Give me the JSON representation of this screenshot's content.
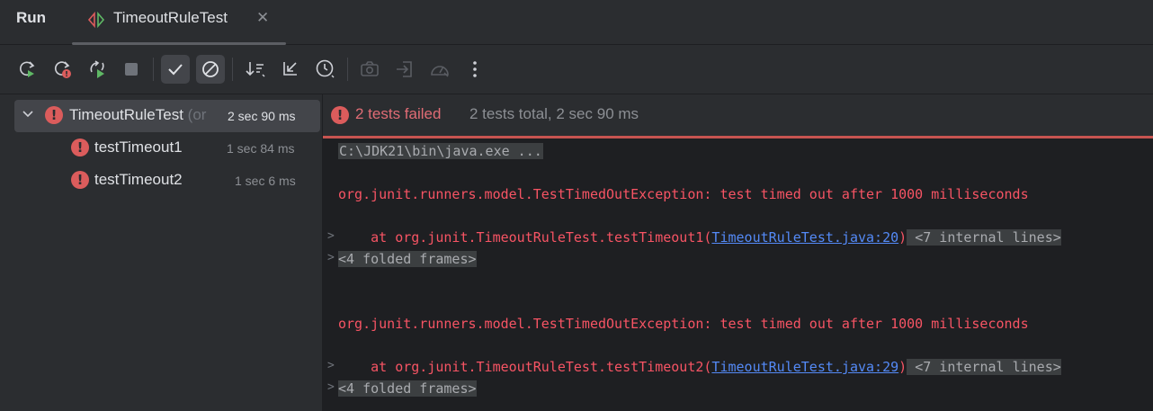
{
  "header": {
    "title": "Run",
    "tab_label": "TimeoutRuleTest",
    "close_glyph": "✕"
  },
  "toolbar": {
    "buttons": [
      "rerun-icon",
      "rerun-failed-icon",
      "toggle-autotest-icon",
      "stop-icon",
      "show-passed-icon",
      "show-ignored-icon",
      "sort-alphabetically-icon",
      "collapse-all-icon",
      "sort-by-duration-icon",
      "screenshot-icon",
      "import-tests-icon",
      "coverage-icon",
      "more-icon"
    ]
  },
  "tree": {
    "root": {
      "label": "TimeoutRuleTest",
      "suffix": "(or",
      "time": "2 sec 90 ms"
    },
    "children": [
      {
        "label": "testTimeout1",
        "time": "1 sec 84 ms"
      },
      {
        "label": "testTimeout2",
        "time": "1 sec 6 ms"
      }
    ]
  },
  "status": {
    "failed": "2 tests failed",
    "total": "2 tests total, 2 sec 90 ms"
  },
  "console": {
    "command": "C:\\JDK21\\bin\\java.exe ...",
    "exception": "org.junit.runners.model.TestTimedOutException: test timed out after 1000 milliseconds",
    "frame1_prefix": "    at org.junit.TimeoutRuleTest.testTimeout1(",
    "frame1_link": "TimeoutRuleTest.java:20",
    "frame2_prefix": "    at org.junit.TimeoutRuleTest.testTimeout2(",
    "frame2_link": "TimeoutRuleTest.java:29",
    "frame_suffix": ")",
    "internal_lines": " <7 internal lines>",
    "folded_frames": "<4 folded frames>",
    "expand_glyph": ">"
  },
  "colors": {
    "error": "#db5c5c",
    "link": "#548af7",
    "exception_text": "#f75464"
  }
}
